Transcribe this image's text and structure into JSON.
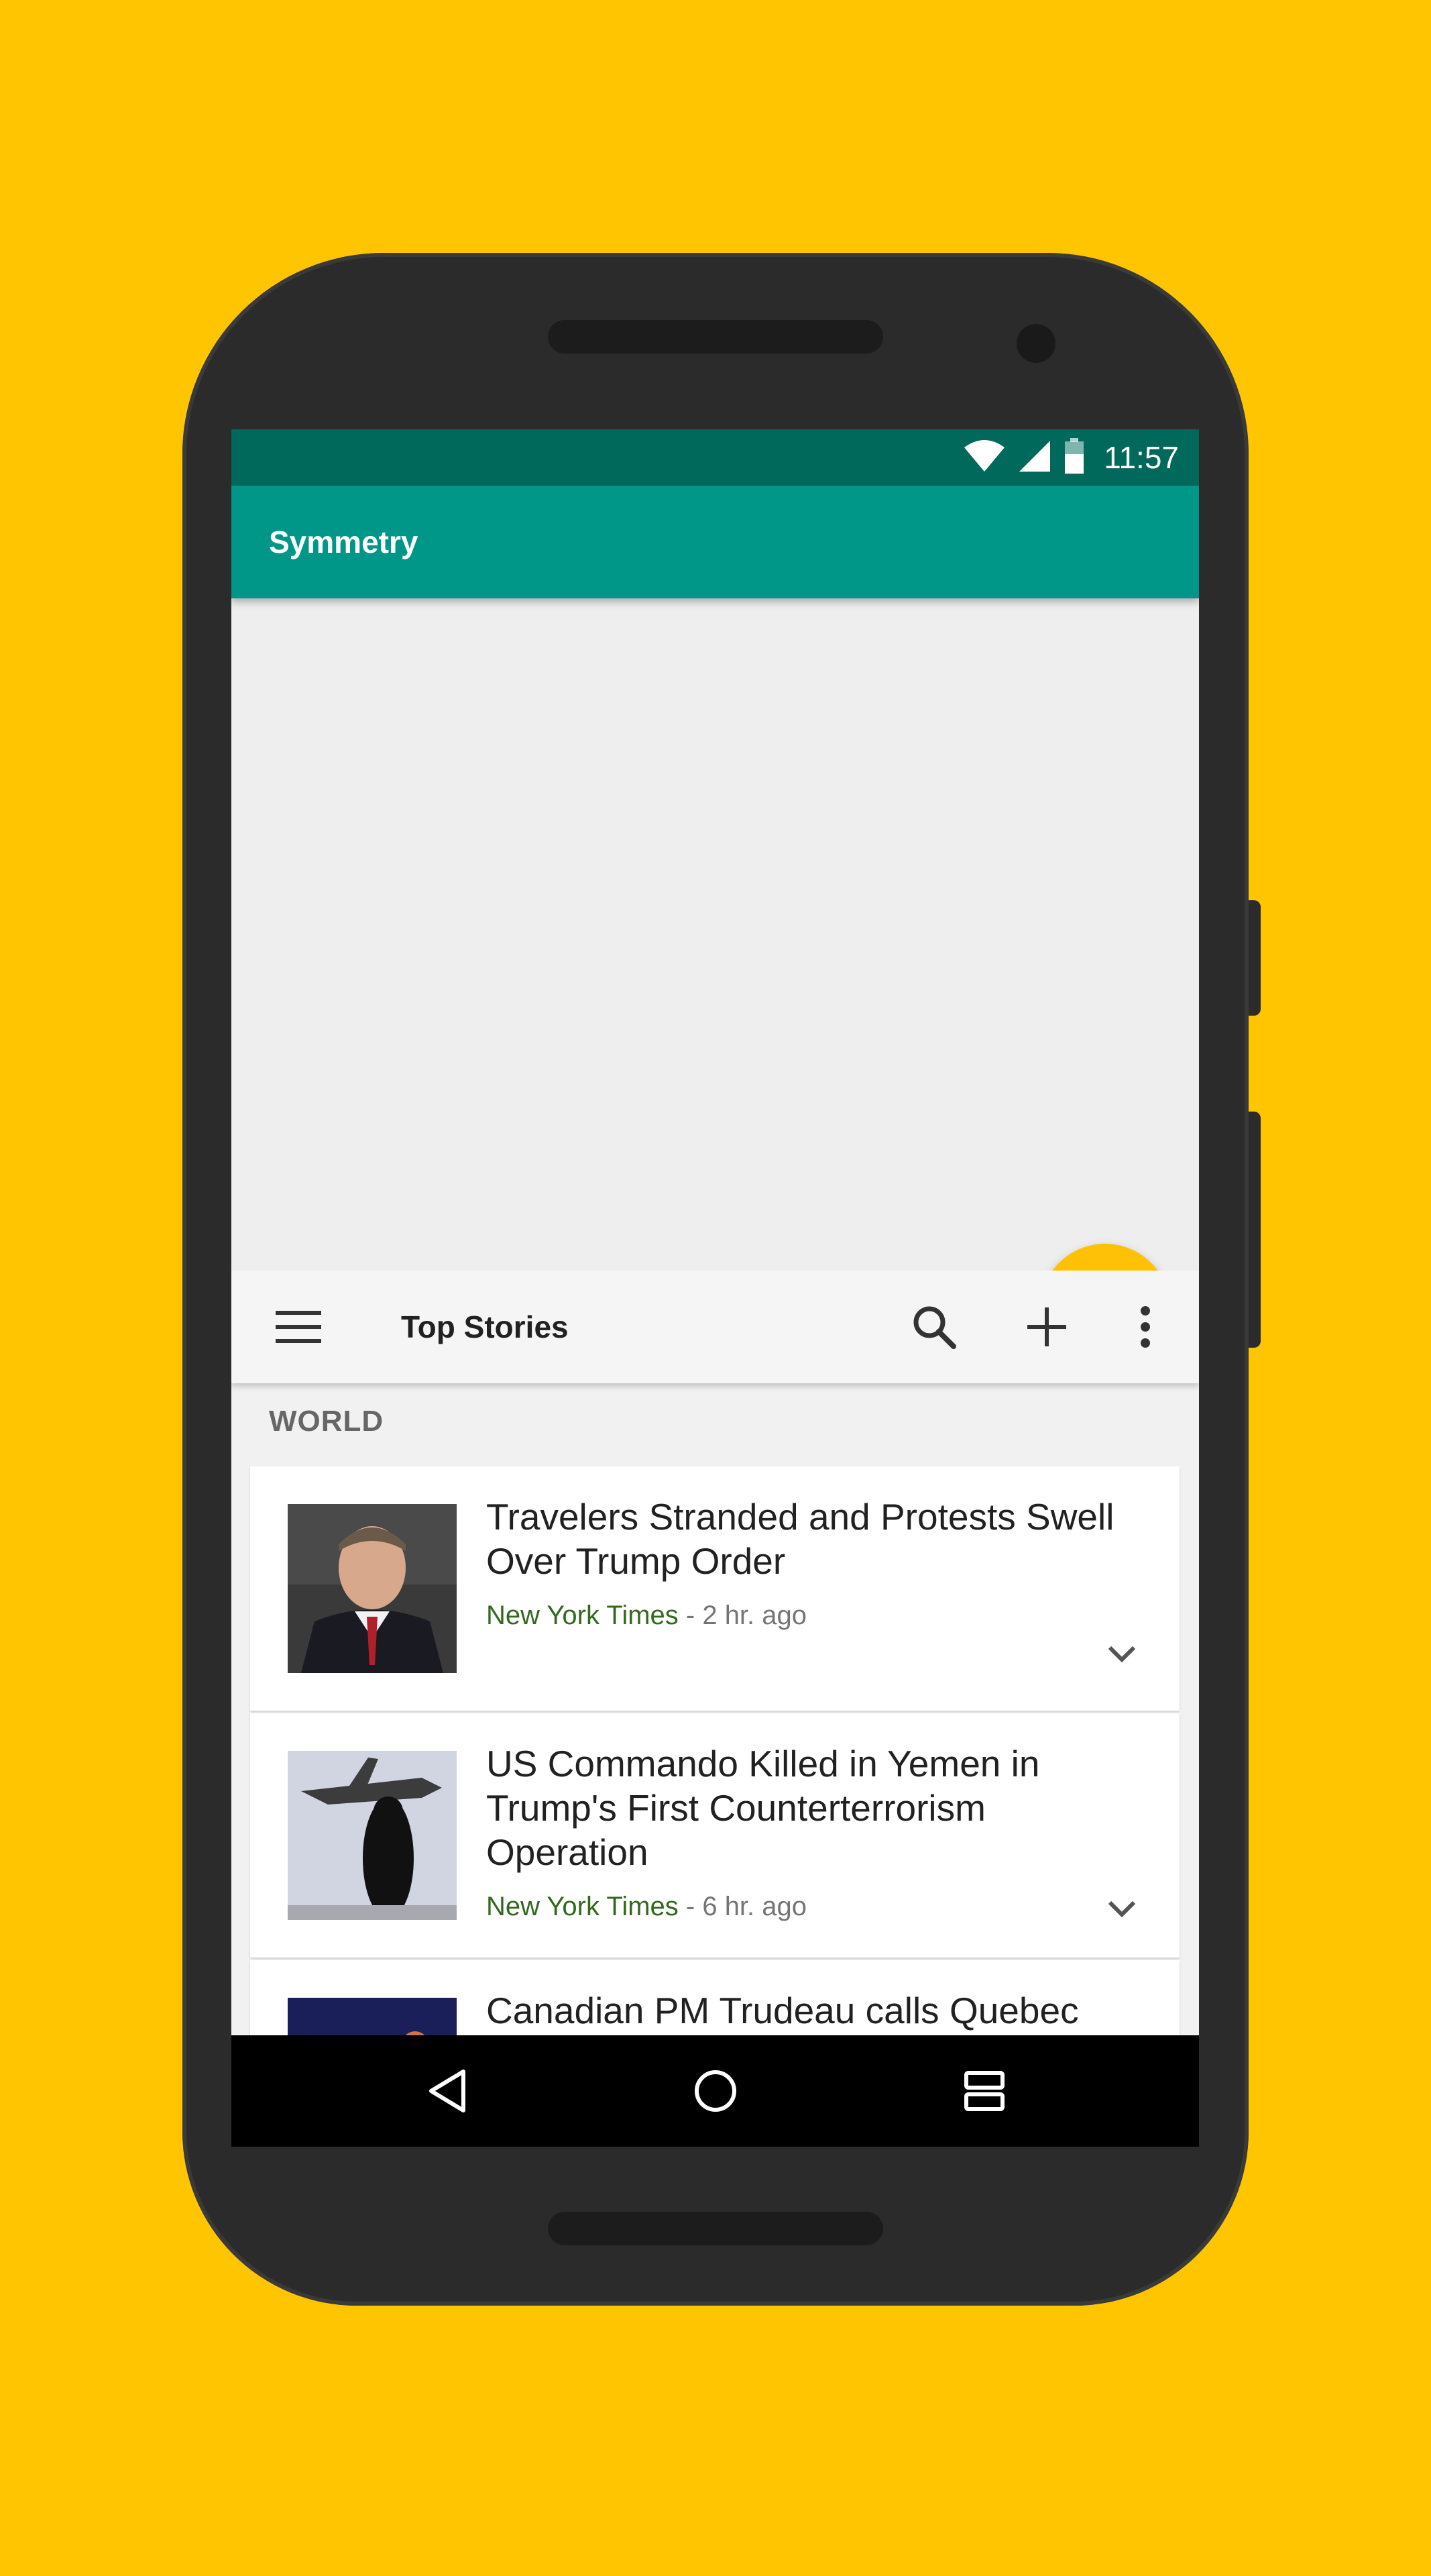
{
  "status_bar": {
    "time": "11:57",
    "icons": [
      "wifi-icon",
      "cell-signal-icon",
      "battery-icon"
    ]
  },
  "top_app": {
    "title": "Symmetry",
    "fab_icon": "cast-icon",
    "colors": {
      "primary": "#009688",
      "primary_dark": "#00695C",
      "accent": "#FFC107"
    }
  },
  "bottom_app": {
    "toolbar": {
      "menu_icon": "hamburger-menu-icon",
      "title": "Top Stories",
      "actions": [
        "search-icon",
        "add-icon",
        "more-vert-icon"
      ]
    },
    "section": "WORLD",
    "stories": [
      {
        "headline": "Travelers Stranded and Protests Swell Over Trump Order",
        "source": "New York Times",
        "time": " - 2 hr. ago"
      },
      {
        "headline": "US Commando Killed in Yemen in Trump's First Counterterrorism Operation",
        "source": "New York Times",
        "time": " - 6 hr. ago"
      },
      {
        "headline": "Canadian PM Trudeau calls Quebec",
        "source": "",
        "time": ""
      }
    ]
  },
  "nav_bar": {
    "buttons": [
      "back-icon",
      "home-icon",
      "recents-icon"
    ]
  },
  "background_color": "#FFC500"
}
